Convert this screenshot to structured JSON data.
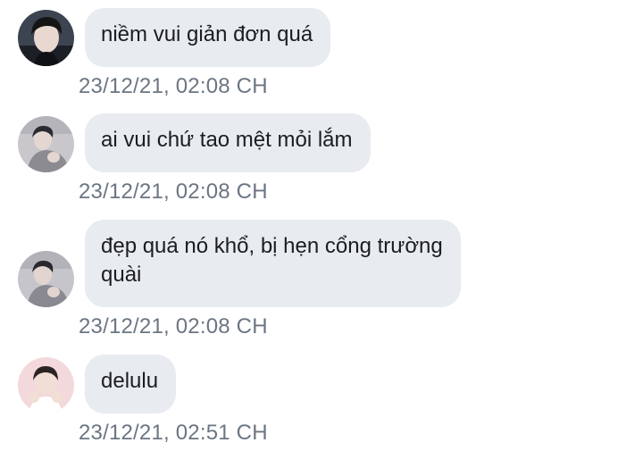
{
  "messages": [
    {
      "avatar_icon": "profile-photo-young-man-dark-hair",
      "lines": [
        "niềm vui giản đơn quá"
      ],
      "timestamp": "23/12/21, 02:08 CH"
    },
    {
      "avatar_icon": "profile-photo-man-grey-sweater",
      "lines": [
        "ai vui chứ tao mệt mỏi lắm"
      ],
      "timestamp": "23/12/21, 02:08 CH"
    },
    {
      "avatar_icon": "profile-photo-man-grey-sweater",
      "lines": [
        "đẹp quá nó khổ, bị hẹn cổng trường",
        "quài"
      ],
      "timestamp": "23/12/21, 02:08 CH"
    },
    {
      "avatar_icon": "profile-photo-pink-background",
      "lines": [
        "delulu"
      ],
      "timestamp": "23/12/21, 02:51 CH"
    }
  ],
  "colors": {
    "bubble_background": "#e8ebef",
    "message_text": "#1a1d21",
    "timestamp_text": "#6b7682",
    "page_background": "#ffffff"
  }
}
